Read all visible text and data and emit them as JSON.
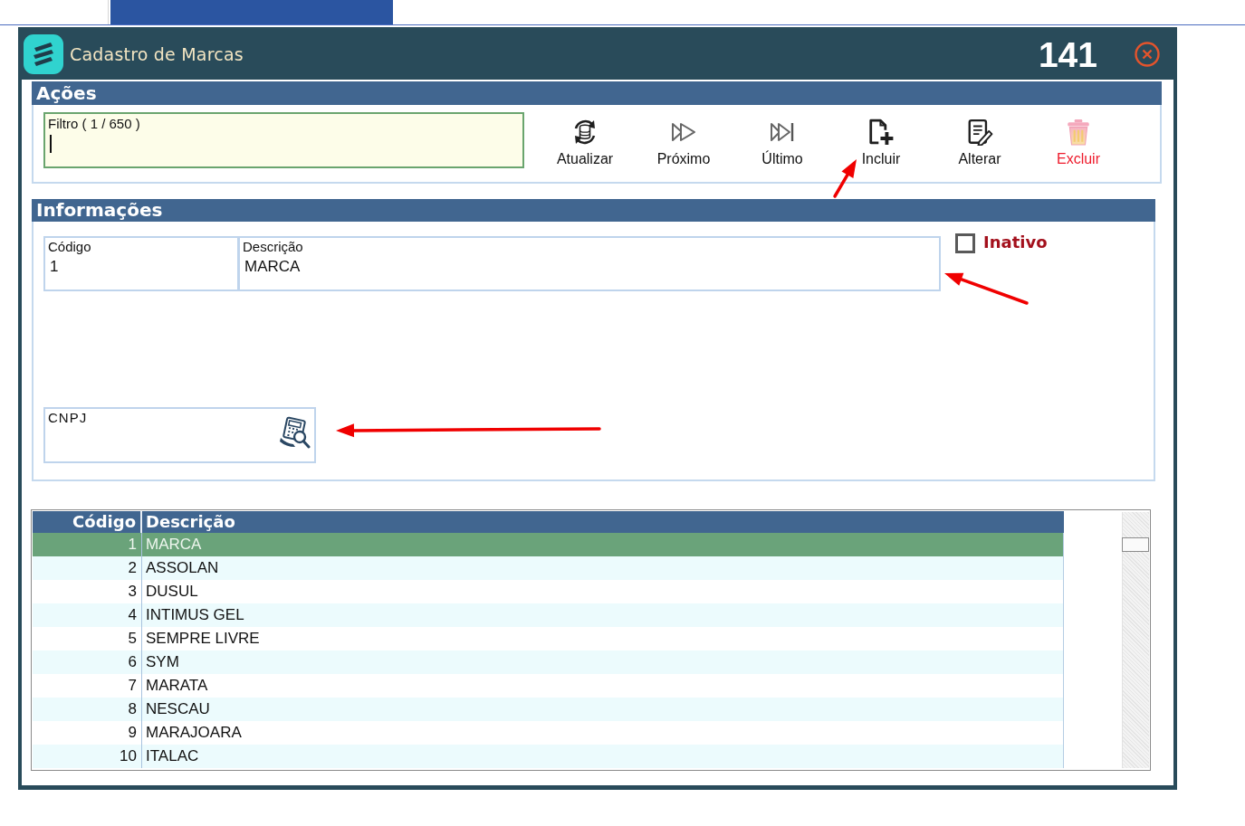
{
  "tabs": [
    {
      "selected": false
    },
    {
      "selected": true
    }
  ],
  "window": {
    "title": "Cadastro de Marcas",
    "screen_code": "141"
  },
  "actions": {
    "title": "Ações",
    "filter": {
      "label": "Filtro ( 1 / 650 )"
    },
    "buttons": [
      {
        "label": "Atualizar",
        "kind": "normal"
      },
      {
        "label": "Próximo",
        "kind": "normal"
      },
      {
        "label": "Último",
        "kind": "normal"
      },
      {
        "label": "Incluir",
        "kind": "normal"
      },
      {
        "label": "Alterar",
        "kind": "normal"
      },
      {
        "label": "Excluir",
        "kind": "danger"
      }
    ]
  },
  "info": {
    "title": "Informações",
    "fields": [
      {
        "label": "Código",
        "value": "1"
      },
      {
        "label": "Descrição",
        "value": "MARCA"
      }
    ],
    "inactive": {
      "label": "Inativo",
      "checked": false
    },
    "cnpj": {
      "label": "CNPJ"
    }
  },
  "table": {
    "columns": [
      "Código",
      "Descrição"
    ],
    "rows": [
      {
        "code": "1",
        "description": "MARCA",
        "selected": true
      },
      {
        "code": "2",
        "description": "ASSOLAN",
        "selected": false
      },
      {
        "code": "3",
        "description": "DUSUL",
        "selected": false
      },
      {
        "code": "4",
        "description": "INTIMUS GEL",
        "selected": false
      },
      {
        "code": "5",
        "description": "SEMPRE LIVRE",
        "selected": false
      },
      {
        "code": "6",
        "description": "SYM",
        "selected": false
      },
      {
        "code": "7",
        "description": "MARATA",
        "selected": false
      },
      {
        "code": "8",
        "description": "NESCAU",
        "selected": false
      },
      {
        "code": "9",
        "description": "MARAJOARA",
        "selected": false
      },
      {
        "code": "10",
        "description": "ITALAC",
        "selected": false
      }
    ]
  },
  "annotations": [
    {
      "kind": "arrow"
    },
    {
      "kind": "arrow"
    },
    {
      "kind": "arrow"
    }
  ]
}
